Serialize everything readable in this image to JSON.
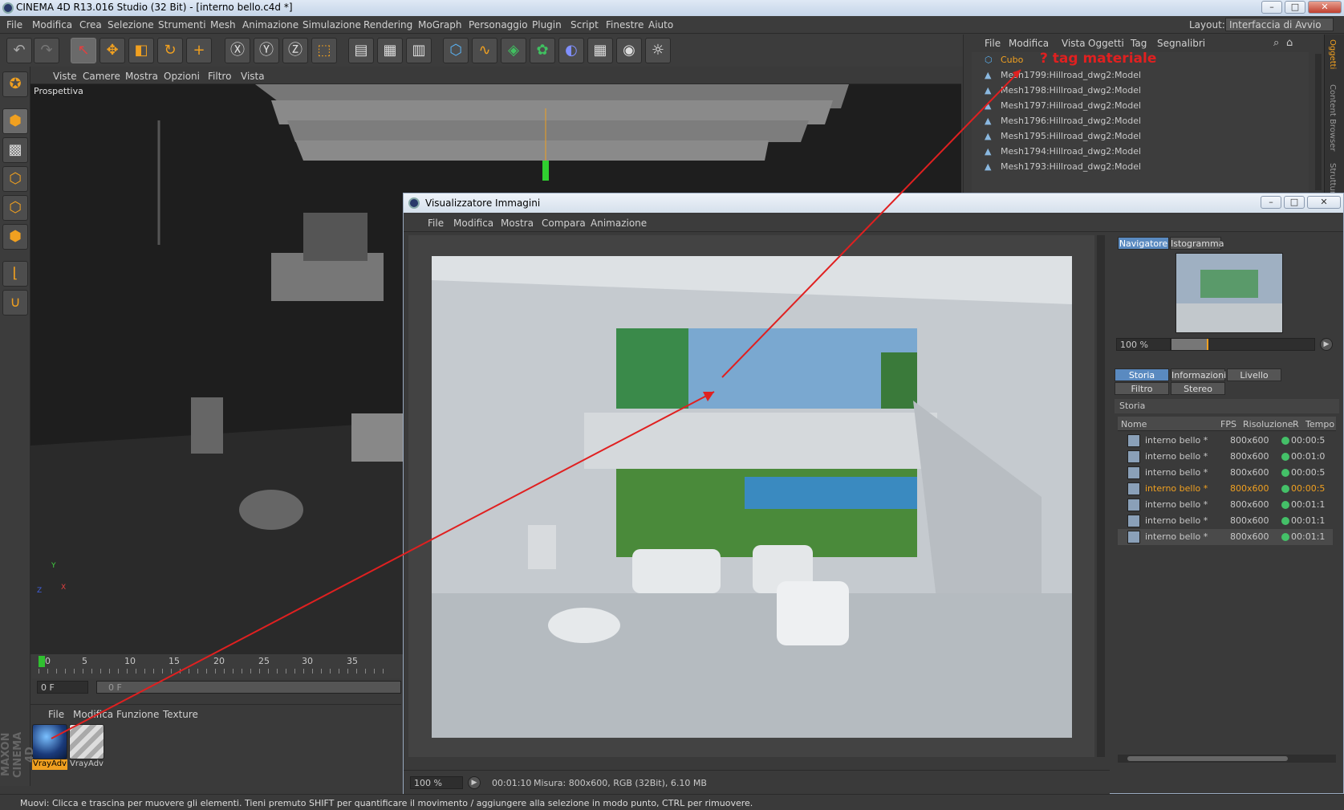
{
  "app": {
    "title": "CINEMA 4D R13.016 Studio (32 Bit) - [interno bello.c4d *]",
    "layout_label": "Layout:",
    "layout_value": "Interfaccia di Avvio",
    "window_controls": [
      "–",
      "□",
      "✕"
    ]
  },
  "menubar": [
    "File",
    "Modifica",
    "Crea",
    "Selezione",
    "Strumenti",
    "Mesh",
    "Animazione",
    "Simulazione",
    "Rendering",
    "MoGraph",
    "Personaggio",
    "Plugin",
    "Script",
    "Finestre",
    "Aiuto"
  ],
  "viewport": {
    "menu": [
      "Viste",
      "Camere",
      "Mostra",
      "Opzioni",
      "Filtro",
      "Vista"
    ],
    "label": "Prospettiva",
    "axes": {
      "x": "X",
      "y": "Y",
      "z": "Z"
    }
  },
  "timeline": {
    "ticks": [
      "0",
      "5",
      "10",
      "15",
      "20",
      "25",
      "30",
      "35"
    ],
    "frame_field": "0 F",
    "frame_field2": "0 F"
  },
  "material_manager": {
    "menu": [
      "File",
      "Modifica",
      "Funzione",
      "Texture"
    ],
    "materials": [
      {
        "name": "VrayAdv",
        "selected": true
      },
      {
        "name": "VrayAdv",
        "selected": false
      }
    ]
  },
  "brand": "MAXON CINEMA 4D",
  "object_manager": {
    "menu": [
      "File",
      "Modifica",
      "Vista",
      "Oggetti",
      "Tag",
      "Segnalibri"
    ],
    "objects": [
      {
        "name": "Cubo",
        "highlight": true
      },
      {
        "name": "Mesh1799:Hillroad_dwg2:Model"
      },
      {
        "name": "Mesh1798:Hillroad_dwg2:Model"
      },
      {
        "name": "Mesh1797:Hillroad_dwg2:Model"
      },
      {
        "name": "Mesh1796:Hillroad_dwg2:Model"
      },
      {
        "name": "Mesh1795:Hillroad_dwg2:Model"
      },
      {
        "name": "Mesh1794:Hillroad_dwg2:Model"
      },
      {
        "name": "Mesh1793:Hillroad_dwg2:Model"
      }
    ],
    "annotation": "? tag materiale",
    "side_tabs": [
      "Oggetti",
      "Content Browser",
      "Struttura"
    ]
  },
  "viewer": {
    "title": "Visualizzatore Immagini",
    "menu": [
      "File",
      "Modifica",
      "Mostra",
      "Compara",
      "Animazione"
    ],
    "nav_tabs": [
      "Navigatore",
      "Istogramma"
    ],
    "nav_zoom": "100 %",
    "history_tabs": [
      "Storia",
      "Informazioni",
      "Livello",
      "Filtro",
      "Stereo"
    ],
    "history_section": "Storia",
    "history_columns": [
      "Nome",
      "FPS",
      "Risoluzione",
      "R",
      "Tempo"
    ],
    "history_rows": [
      {
        "name": "interno bello *",
        "res": "800x600",
        "time": "00:00:5",
        "active": false,
        "selected": false
      },
      {
        "name": "interno bello *",
        "res": "800x600",
        "time": "00:01:0",
        "active": false,
        "selected": false
      },
      {
        "name": "interno bello *",
        "res": "800x600",
        "time": "00:00:5",
        "active": false,
        "selected": false
      },
      {
        "name": "interno bello *",
        "res": "800x600",
        "time": "00:00:5",
        "active": true,
        "selected": false
      },
      {
        "name": "interno bello *",
        "res": "800x600",
        "time": "00:01:1",
        "active": false,
        "selected": false
      },
      {
        "name": "interno bello *",
        "res": "800x600",
        "time": "00:01:1",
        "active": false,
        "selected": false
      },
      {
        "name": "interno bello *",
        "res": "800x600",
        "time": "00:01:1",
        "active": false,
        "selected": true
      }
    ],
    "status_zoom": "100 %",
    "status_time": "00:01:10",
    "status_info": "Misura: 800x600, RGB (32Bit), 6.10 MB"
  },
  "statusbar": "Muovi: Clicca e trascina per muovere gli elementi. Tieni premuto SHIFT per quantificare il movimento / aggiungere alla selezione in modo punto, CTRL per rimuovere.",
  "colors": {
    "accent_orange": "#f0a020",
    "selection_blue": "#5a8ac0",
    "annotation_red": "#e02020",
    "dot_green": "#44c068"
  }
}
